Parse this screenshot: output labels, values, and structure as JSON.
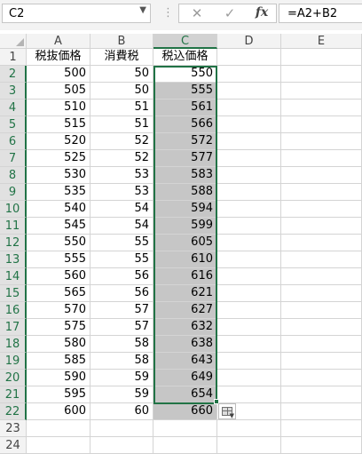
{
  "formula_bar": {
    "name_box": "C2",
    "cancel_glyph": "✕",
    "enter_glyph": "✓",
    "fx_label": "fx",
    "formula": "=A2+B2"
  },
  "sheet": {
    "columns": [
      "A",
      "B",
      "C",
      "D",
      "E"
    ],
    "selected_column": "C",
    "active_cell": "C2",
    "rows": [
      {
        "n": "1",
        "a": "税抜価格",
        "b": "消費税",
        "c": "税込価格"
      },
      {
        "n": "2",
        "a": "500",
        "b": "50",
        "c": "550"
      },
      {
        "n": "3",
        "a": "505",
        "b": "50",
        "c": "555"
      },
      {
        "n": "4",
        "a": "510",
        "b": "51",
        "c": "561"
      },
      {
        "n": "5",
        "a": "515",
        "b": "51",
        "c": "566"
      },
      {
        "n": "6",
        "a": "520",
        "b": "52",
        "c": "572"
      },
      {
        "n": "7",
        "a": "525",
        "b": "52",
        "c": "577"
      },
      {
        "n": "8",
        "a": "530",
        "b": "53",
        "c": "583"
      },
      {
        "n": "9",
        "a": "535",
        "b": "53",
        "c": "588"
      },
      {
        "n": "10",
        "a": "540",
        "b": "54",
        "c": "594"
      },
      {
        "n": "11",
        "a": "545",
        "b": "54",
        "c": "599"
      },
      {
        "n": "12",
        "a": "550",
        "b": "55",
        "c": "605"
      },
      {
        "n": "13",
        "a": "555",
        "b": "55",
        "c": "610"
      },
      {
        "n": "14",
        "a": "560",
        "b": "56",
        "c": "616"
      },
      {
        "n": "15",
        "a": "565",
        "b": "56",
        "c": "621"
      },
      {
        "n": "16",
        "a": "570",
        "b": "57",
        "c": "627"
      },
      {
        "n": "17",
        "a": "575",
        "b": "57",
        "c": "632"
      },
      {
        "n": "18",
        "a": "580",
        "b": "58",
        "c": "638"
      },
      {
        "n": "19",
        "a": "585",
        "b": "58",
        "c": "643"
      },
      {
        "n": "20",
        "a": "590",
        "b": "59",
        "c": "649"
      },
      {
        "n": "21",
        "a": "595",
        "b": "59",
        "c": "654"
      },
      {
        "n": "22",
        "a": "600",
        "b": "60",
        "c": "660"
      },
      {
        "n": "23",
        "a": "",
        "b": "",
        "c": ""
      },
      {
        "n": "24",
        "a": "",
        "b": "",
        "c": ""
      }
    ]
  },
  "colors": {
    "accent": "#217346",
    "selection_fill": "#c6c6c6",
    "header_bg": "#f3f3f3",
    "gridline": "#d4d4d4"
  }
}
